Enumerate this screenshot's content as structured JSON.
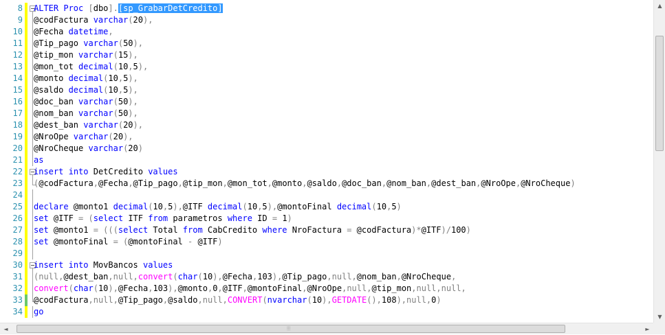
{
  "editor": {
    "lines": [
      {
        "n": "8",
        "fold": true,
        "bar": "yellow",
        "tokens": [
          [
            "kw",
            "ALTER"
          ],
          [
            "tx",
            " "
          ],
          [
            "kw",
            "Proc"
          ],
          [
            "tx",
            " "
          ],
          [
            "op",
            "["
          ],
          [
            "tx",
            "dbo"
          ],
          [
            "op",
            "]."
          ],
          [
            "sel",
            "[sp_GrabarDetCredito]"
          ]
        ]
      },
      {
        "n": "9",
        "bar": "yellow",
        "tokens": [
          [
            "tx",
            "@codFactura "
          ],
          [
            "kw",
            "varchar"
          ],
          [
            "op",
            "("
          ],
          [
            "tx",
            "20"
          ],
          [
            "op",
            "),"
          ]
        ]
      },
      {
        "n": "10",
        "bar": "yellow",
        "tokens": [
          [
            "tx",
            "@Fecha "
          ],
          [
            "kw",
            "datetime"
          ],
          [
            "op",
            ","
          ]
        ]
      },
      {
        "n": "11",
        "bar": "yellow",
        "tokens": [
          [
            "tx",
            "@Tip_pago "
          ],
          [
            "kw",
            "varchar"
          ],
          [
            "op",
            "("
          ],
          [
            "tx",
            "50"
          ],
          [
            "op",
            "),"
          ]
        ]
      },
      {
        "n": "12",
        "bar": "yellow",
        "tokens": [
          [
            "tx",
            "@tip_mon "
          ],
          [
            "kw",
            "varchar"
          ],
          [
            "op",
            "("
          ],
          [
            "tx",
            "15"
          ],
          [
            "op",
            "),"
          ]
        ]
      },
      {
        "n": "13",
        "bar": "yellow",
        "tokens": [
          [
            "tx",
            "@mon_tot "
          ],
          [
            "kw",
            "decimal"
          ],
          [
            "op",
            "("
          ],
          [
            "tx",
            "10"
          ],
          [
            "op",
            ","
          ],
          [
            "tx",
            "5"
          ],
          [
            "op",
            "),"
          ]
        ]
      },
      {
        "n": "14",
        "bar": "yellow",
        "tokens": [
          [
            "tx",
            "@monto "
          ],
          [
            "kw",
            "decimal"
          ],
          [
            "op",
            "("
          ],
          [
            "tx",
            "10"
          ],
          [
            "op",
            ","
          ],
          [
            "tx",
            "5"
          ],
          [
            "op",
            "),"
          ]
        ]
      },
      {
        "n": "15",
        "bar": "yellow",
        "tokens": [
          [
            "tx",
            "@saldo "
          ],
          [
            "kw",
            "decimal"
          ],
          [
            "op",
            "("
          ],
          [
            "tx",
            "10"
          ],
          [
            "op",
            ","
          ],
          [
            "tx",
            "5"
          ],
          [
            "op",
            "),"
          ]
        ]
      },
      {
        "n": "16",
        "bar": "yellow",
        "tokens": [
          [
            "tx",
            "@doc_ban "
          ],
          [
            "kw",
            "varchar"
          ],
          [
            "op",
            "("
          ],
          [
            "tx",
            "50"
          ],
          [
            "op",
            "),"
          ]
        ]
      },
      {
        "n": "17",
        "bar": "yellow",
        "tokens": [
          [
            "tx",
            "@nom_ban "
          ],
          [
            "kw",
            "varchar"
          ],
          [
            "op",
            "("
          ],
          [
            "tx",
            "50"
          ],
          [
            "op",
            "),"
          ]
        ]
      },
      {
        "n": "18",
        "bar": "yellow",
        "tokens": [
          [
            "tx",
            "@dest_ban "
          ],
          [
            "kw",
            "varchar"
          ],
          [
            "op",
            "("
          ],
          [
            "tx",
            "20"
          ],
          [
            "op",
            "),"
          ]
        ]
      },
      {
        "n": "19",
        "bar": "yellow",
        "tokens": [
          [
            "tx",
            "@NroOpe "
          ],
          [
            "kw",
            "varchar"
          ],
          [
            "op",
            "("
          ],
          [
            "tx",
            "20"
          ],
          [
            "op",
            "),"
          ]
        ]
      },
      {
        "n": "20",
        "bar": "yellow",
        "tokens": [
          [
            "tx",
            "@NroCheque "
          ],
          [
            "kw",
            "varchar"
          ],
          [
            "op",
            "("
          ],
          [
            "tx",
            "20"
          ],
          [
            "op",
            ")"
          ]
        ]
      },
      {
        "n": "21",
        "bar": "yellow",
        "tokens": [
          [
            "kw",
            "as"
          ]
        ]
      },
      {
        "n": "22",
        "fold": true,
        "bar": "yellow",
        "tokens": [
          [
            "kw",
            "insert"
          ],
          [
            "tx",
            " "
          ],
          [
            "kw",
            "into"
          ],
          [
            "tx",
            " DetCredito "
          ],
          [
            "kw",
            "values"
          ]
        ]
      },
      {
        "n": "23",
        "bar": "yellow",
        "end": true,
        "tokens": [
          [
            "op",
            "("
          ],
          [
            "tx",
            "@codFactura"
          ],
          [
            "op",
            ","
          ],
          [
            "tx",
            "@Fecha"
          ],
          [
            "op",
            ","
          ],
          [
            "tx",
            "@Tip_pago"
          ],
          [
            "op",
            ","
          ],
          [
            "tx",
            "@tip_mon"
          ],
          [
            "op",
            ","
          ],
          [
            "tx",
            "@mon_tot"
          ],
          [
            "op",
            ","
          ],
          [
            "tx",
            "@monto"
          ],
          [
            "op",
            ","
          ],
          [
            "tx",
            "@saldo"
          ],
          [
            "op",
            ","
          ],
          [
            "tx",
            "@doc_ban"
          ],
          [
            "op",
            ","
          ],
          [
            "tx",
            "@nom_ban"
          ],
          [
            "op",
            ","
          ],
          [
            "tx",
            "@dest_ban"
          ],
          [
            "op",
            ","
          ],
          [
            "tx",
            "@NroOpe"
          ],
          [
            "op",
            ","
          ],
          [
            "tx",
            "@NroCheque"
          ],
          [
            "op",
            ")"
          ]
        ]
      },
      {
        "n": "24",
        "bar": "yellow",
        "tokens": []
      },
      {
        "n": "25",
        "bar": "yellow",
        "tokens": [
          [
            "kw",
            "declare"
          ],
          [
            "tx",
            " @monto1 "
          ],
          [
            "kw",
            "decimal"
          ],
          [
            "op",
            "("
          ],
          [
            "tx",
            "10"
          ],
          [
            "op",
            ","
          ],
          [
            "tx",
            "5"
          ],
          [
            "op",
            "),"
          ],
          [
            "tx",
            "@ITF "
          ],
          [
            "kw",
            "decimal"
          ],
          [
            "op",
            "("
          ],
          [
            "tx",
            "10"
          ],
          [
            "op",
            ","
          ],
          [
            "tx",
            "5"
          ],
          [
            "op",
            "),"
          ],
          [
            "tx",
            "@montoFinal "
          ],
          [
            "kw",
            "decimal"
          ],
          [
            "op",
            "("
          ],
          [
            "tx",
            "10"
          ],
          [
            "op",
            ","
          ],
          [
            "tx",
            "5"
          ],
          [
            "op",
            ")"
          ]
        ]
      },
      {
        "n": "26",
        "bar": "yellow",
        "tokens": [
          [
            "kw",
            "set"
          ],
          [
            "tx",
            " @ITF "
          ],
          [
            "op",
            "= ("
          ],
          [
            "kw",
            "select"
          ],
          [
            "tx",
            " ITF "
          ],
          [
            "kw",
            "from"
          ],
          [
            "tx",
            " parametros "
          ],
          [
            "kw",
            "where"
          ],
          [
            "tx",
            " ID "
          ],
          [
            "op",
            "="
          ],
          [
            "tx",
            " 1"
          ],
          [
            "op",
            ")"
          ]
        ]
      },
      {
        "n": "27",
        "bar": "yellow",
        "tokens": [
          [
            "kw",
            "set"
          ],
          [
            "tx",
            " @monto1 "
          ],
          [
            "op",
            "= ((("
          ],
          [
            "kw",
            "select"
          ],
          [
            "tx",
            " Total "
          ],
          [
            "kw",
            "from"
          ],
          [
            "tx",
            " CabCredito "
          ],
          [
            "kw",
            "where"
          ],
          [
            "tx",
            " NroFactura "
          ],
          [
            "op",
            "="
          ],
          [
            "tx",
            " @codFactura"
          ],
          [
            "op",
            ")*"
          ],
          [
            "tx",
            "@ITF"
          ],
          [
            "op",
            ")/"
          ],
          [
            "tx",
            "100"
          ],
          [
            "op",
            ")"
          ]
        ]
      },
      {
        "n": "28",
        "bar": "yellow",
        "tokens": [
          [
            "kw",
            "set"
          ],
          [
            "tx",
            " @montoFinal "
          ],
          [
            "op",
            "= ("
          ],
          [
            "tx",
            "@montoFinal "
          ],
          [
            "op",
            "-"
          ],
          [
            "tx",
            " @ITF"
          ],
          [
            "op",
            ")"
          ]
        ]
      },
      {
        "n": "29",
        "bar": "yellow",
        "tokens": []
      },
      {
        "n": "30",
        "fold": true,
        "bar": "yellow",
        "tokens": [
          [
            "kw",
            "insert"
          ],
          [
            "tx",
            " "
          ],
          [
            "kw",
            "into"
          ],
          [
            "tx",
            " MovBancos "
          ],
          [
            "kw",
            "values"
          ]
        ]
      },
      {
        "n": "31",
        "bar": "yellow",
        "tokens": [
          [
            "op",
            "("
          ],
          [
            "op",
            "null"
          ],
          [
            "op",
            ","
          ],
          [
            "tx",
            "@dest_ban"
          ],
          [
            "op",
            ","
          ],
          [
            "op",
            "null"
          ],
          [
            "op",
            ","
          ],
          [
            "fn",
            "convert"
          ],
          [
            "op",
            "("
          ],
          [
            "kw",
            "char"
          ],
          [
            "op",
            "("
          ],
          [
            "tx",
            "10"
          ],
          [
            "op",
            "),"
          ],
          [
            "tx",
            "@Fecha"
          ],
          [
            "op",
            ","
          ],
          [
            "tx",
            "103"
          ],
          [
            "op",
            "),"
          ],
          [
            "tx",
            "@Tip_pago"
          ],
          [
            "op",
            ","
          ],
          [
            "op",
            "null"
          ],
          [
            "op",
            ","
          ],
          [
            "tx",
            "@nom_ban"
          ],
          [
            "op",
            ","
          ],
          [
            "tx",
            "@NroCheque"
          ],
          [
            "op",
            ","
          ]
        ]
      },
      {
        "n": "32",
        "bar": "yellow",
        "tokens": [
          [
            "fn",
            "convert"
          ],
          [
            "op",
            "("
          ],
          [
            "kw",
            "char"
          ],
          [
            "op",
            "("
          ],
          [
            "tx",
            "10"
          ],
          [
            "op",
            "),"
          ],
          [
            "tx",
            "@Fecha"
          ],
          [
            "op",
            ","
          ],
          [
            "tx",
            "103"
          ],
          [
            "op",
            "),"
          ],
          [
            "tx",
            "@monto"
          ],
          [
            "op",
            ","
          ],
          [
            "tx",
            "0"
          ],
          [
            "op",
            ","
          ],
          [
            "tx",
            "@ITF"
          ],
          [
            "op",
            ","
          ],
          [
            "tx",
            "@montoFinal"
          ],
          [
            "op",
            ","
          ],
          [
            "tx",
            "@NroOpe"
          ],
          [
            "op",
            ","
          ],
          [
            "op",
            "null"
          ],
          [
            "op",
            ","
          ],
          [
            "tx",
            "@tip_mon"
          ],
          [
            "op",
            ","
          ],
          [
            "op",
            "null"
          ],
          [
            "op",
            ","
          ],
          [
            "op",
            "null"
          ],
          [
            "op",
            ","
          ]
        ]
      },
      {
        "n": "33",
        "bar": "green",
        "end": true,
        "tokens": [
          [
            "tx",
            "@codFactura"
          ],
          [
            "op",
            ","
          ],
          [
            "op",
            "null"
          ],
          [
            "op",
            ","
          ],
          [
            "tx",
            "@Tip_pago"
          ],
          [
            "op",
            ","
          ],
          [
            "tx",
            "@saldo"
          ],
          [
            "op",
            ","
          ],
          [
            "op",
            "null"
          ],
          [
            "op",
            ","
          ],
          [
            "fn",
            "CONVERT"
          ],
          [
            "op",
            "("
          ],
          [
            "kw",
            "nvarchar"
          ],
          [
            "op",
            "("
          ],
          [
            "tx",
            "10"
          ],
          [
            "op",
            "),"
          ],
          [
            "fn",
            "GETDATE"
          ],
          [
            "op",
            "(),"
          ],
          [
            "tx",
            "108"
          ],
          [
            "op",
            "),"
          ],
          [
            "op",
            "null"
          ],
          [
            "op",
            ","
          ],
          [
            "tx",
            "0"
          ],
          [
            "op",
            ")"
          ]
        ]
      },
      {
        "n": "34",
        "bar": "yellow",
        "tokens": [
          [
            "kw",
            "go"
          ]
        ]
      }
    ]
  },
  "scrollbars": {
    "up_arrow": "▲",
    "down_arrow": "▼",
    "left_arrow": "◄",
    "right_arrow": "►",
    "grip": "⦙⦙⦙"
  },
  "colors": {
    "keyword": "#0000ff",
    "function": "#ff00ff",
    "operator": "#808080",
    "line_number": "#2b91af",
    "selection": "#3399ff",
    "changed_bar": "#ffff00",
    "saved_bar": "#6cc86c"
  }
}
